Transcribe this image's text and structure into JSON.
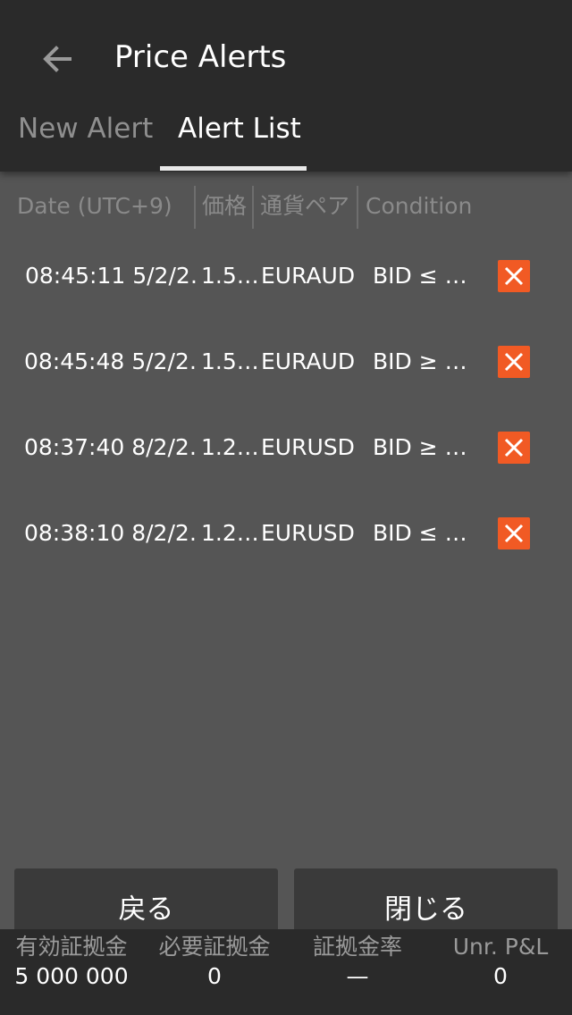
{
  "header": {
    "back_icon": "arrow-left-icon",
    "title": "Price Alerts"
  },
  "tabs": [
    {
      "label": "New Alert",
      "active": false
    },
    {
      "label": "Alert List",
      "active": true
    }
  ],
  "table": {
    "columns": [
      "Date (UTC+9)",
      "価格",
      "通貨ペア",
      "Condition"
    ],
    "rows": [
      {
        "date": "08:45:11 5/2/2…",
        "price": "1.5…",
        "pair": "EURAUD",
        "condition": "BID ≤ …"
      },
      {
        "date": "08:45:48 5/2/2…",
        "price": "1.5…",
        "pair": "EURAUD",
        "condition": "BID ≥ …"
      },
      {
        "date": "08:37:40 8/2/2…",
        "price": "1.2…",
        "pair": "EURUSD",
        "condition": "BID ≥ …"
      },
      {
        "date": "08:38:10 8/2/2…",
        "price": "1.2…",
        "pair": "EURUSD",
        "condition": "BID ≤ …"
      }
    ],
    "delete_icon": "close-icon"
  },
  "buttons": {
    "back_label": "戻る",
    "close_label": "閉じる"
  },
  "footer": [
    {
      "label": "有効証拠金",
      "value": "5 000 000"
    },
    {
      "label": "必要証拠金",
      "value": "0"
    },
    {
      "label": "証拠金率",
      "value": "—"
    },
    {
      "label": "Unr. P&L",
      "value": "0"
    }
  ],
  "colors": {
    "background": "#555555",
    "topbar": "#2a2a2a",
    "delete_accent": "#f15a24",
    "muted_text": "#8a8a8a"
  }
}
